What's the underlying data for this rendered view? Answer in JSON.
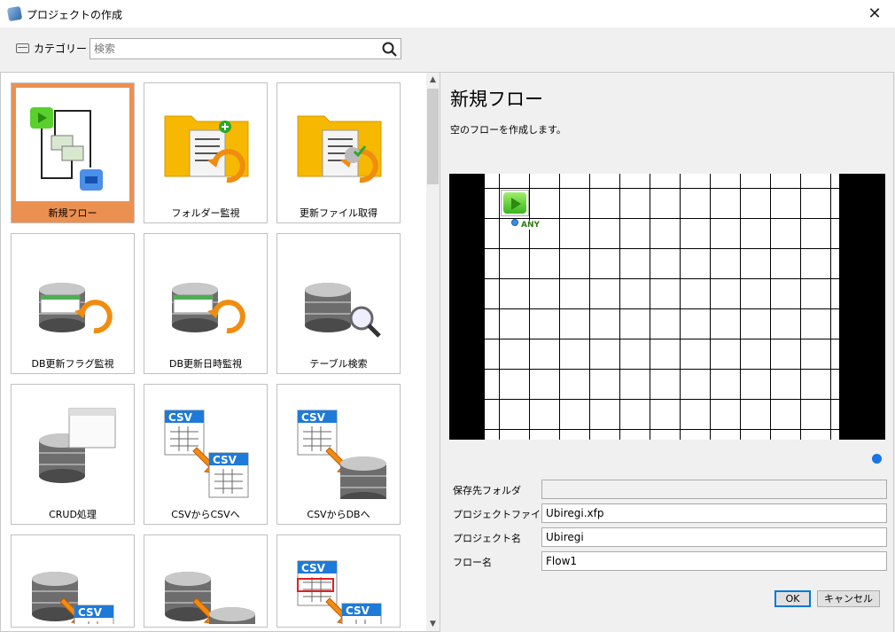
{
  "window": {
    "title": "プロジェクトの作成",
    "close_label": "✕"
  },
  "toolbar": {
    "category_label": "カテゴリー",
    "search_placeholder": "検索"
  },
  "templates": [
    {
      "label": "新規フロー",
      "icon": "flow",
      "selected": true
    },
    {
      "label": "フォルダー監視",
      "icon": "folder-add"
    },
    {
      "label": "更新ファイル取得",
      "icon": "folder-time"
    },
    {
      "label": "DB更新フラグ監視",
      "icon": "db-flag"
    },
    {
      "label": "DB更新日時監視",
      "icon": "db-time"
    },
    {
      "label": "テーブル検索",
      "icon": "db-search"
    },
    {
      "label": "CRUD処理",
      "icon": "db-window"
    },
    {
      "label": "CSVからCSVへ",
      "icon": "csv-csv"
    },
    {
      "label": "CSVからDBへ",
      "icon": "csv-db"
    },
    {
      "label": "",
      "icon": "db-csv"
    },
    {
      "label": "",
      "icon": "db-db"
    },
    {
      "label": "",
      "icon": "csv-error"
    }
  ],
  "detail": {
    "title": "新規フロー",
    "description": "空のフローを作成します。",
    "node_label": "ANY"
  },
  "form": {
    "folder_label": "保存先フォルダ",
    "folder_value": "",
    "file_label": "プロジェクトファイル名",
    "file_value": "Ubiregi.xfp",
    "project_label": "プロジェクト名",
    "project_value": "Ubiregi",
    "flow_label": "フロー名",
    "flow_value": "Flow1"
  },
  "buttons": {
    "ok": "OK",
    "cancel": "キャンセル"
  },
  "colors": {
    "selected": "#eb9051",
    "accent": "#0078d7"
  }
}
